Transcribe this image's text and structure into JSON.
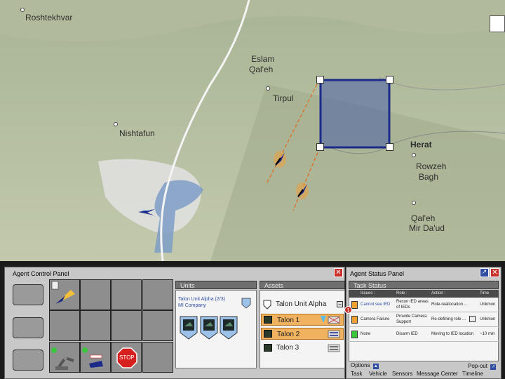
{
  "map": {
    "places": [
      "Roshtekhvar",
      "Eslam",
      "Qal'eh",
      "Tirpul",
      "Nishtafun",
      "Herat",
      "Rowzeh",
      "Bagh",
      "Qal'eh",
      "Mir Da'ud"
    ]
  },
  "agent_control_panel": {
    "title": "Agent Control Panel",
    "close_label": "✕",
    "stop_label": "STOP",
    "units": {
      "header": "Units",
      "unit_name": "Talon Unit Alpha (2/3)",
      "company": "MI Company"
    },
    "assets": {
      "header": "Assets",
      "selected_unit": "Talon Unit Alpha",
      "collapse_label": "−",
      "items": [
        "Talon 1",
        "Talon 2",
        "Talon 3"
      ]
    }
  },
  "agent_status_panel": {
    "title": "Agent Status Panel",
    "close_label": "✕",
    "popout_icon_label": "↗",
    "task_status": {
      "header": "Task Status",
      "columns": [
        "Issues :",
        "Role :",
        "Action :",
        "Time"
      ],
      "alert_count": "1",
      "rows": [
        {
          "issue": "Cannot see IED",
          "role_line1": "Recon IED areas",
          "role_line2": "of IEDs",
          "action": "Role-reallocation ...",
          "time": "Unkmon"
        },
        {
          "issue": "Camera Failure",
          "role_line1": "Provide Camera",
          "role_line2": "Support",
          "action": "Re-defining role ...",
          "time": "Unkmon"
        },
        {
          "issue": "None",
          "role_line1": "Disarm IED",
          "role_line2": "",
          "action": "Moving to IED location",
          "time": "~10 min"
        }
      ],
      "options_label": "Options",
      "popout_label": "Pop-out",
      "tabs": [
        "Task",
        "Vehicle",
        "Sensors",
        "Message Center",
        "Timeline"
      ]
    }
  },
  "colors": {
    "selection_box": "#1c2a8a",
    "selected_row": "#f0b25f",
    "close_button": "#c9302c",
    "popout_button": "#2f4ea3"
  }
}
